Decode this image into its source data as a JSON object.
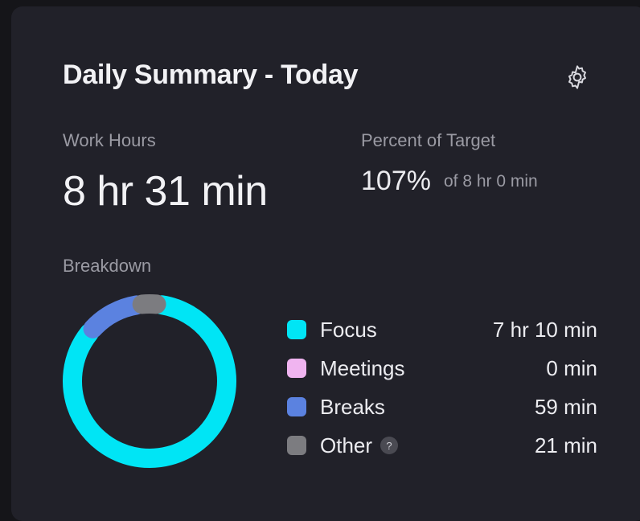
{
  "header": {
    "title": "Daily Summary - Today",
    "settings_icon": "gear-icon"
  },
  "work_hours": {
    "label": "Work Hours",
    "value": "8 hr 31 min"
  },
  "percent_target": {
    "label": "Percent of Target",
    "value": "107%",
    "target_text": "of 8 hr 0 min"
  },
  "breakdown": {
    "label": "Breakdown",
    "items": [
      {
        "name": "Focus",
        "value": "7 hr 10 min",
        "minutes": 430,
        "color": "#00e5f5"
      },
      {
        "name": "Meetings",
        "value": "0 min",
        "minutes": 0,
        "color": "#f0b4f0"
      },
      {
        "name": "Breaks",
        "value": "59 min",
        "minutes": 59,
        "color": "#5b82e0"
      },
      {
        "name": "Other",
        "value": "21 min",
        "minutes": 21,
        "color": "#7c7c80",
        "help_icon": "question-icon",
        "help_text": "?"
      }
    ]
  }
}
